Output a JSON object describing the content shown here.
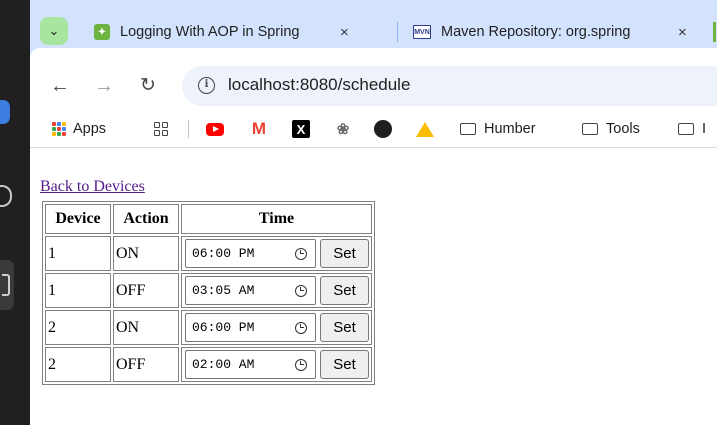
{
  "browser": {
    "tabs": [
      {
        "title": "Logging With AOP in Spring",
        "close": "×",
        "favicon": "spring-leaf-icon"
      },
      {
        "title": "Maven Repository: org.spring",
        "close": "×",
        "favicon": "mvn-icon"
      }
    ],
    "url": "localhost:8080/schedule"
  },
  "bookmarks": {
    "apps_label": "Apps",
    "items": [
      {
        "label": "Humber",
        "icon": "folder-icon"
      },
      {
        "label": "Tools",
        "icon": "folder-icon"
      },
      {
        "label": "I",
        "icon": "folder-icon"
      }
    ]
  },
  "page": {
    "back_link": "Back to Devices",
    "table": {
      "headers": {
        "device": "Device",
        "action": "Action",
        "time": "Time"
      },
      "set_label": "Set",
      "rows": [
        {
          "device": "1",
          "action": "ON",
          "time": "06:00 PM"
        },
        {
          "device": "1",
          "action": "OFF",
          "time": "03:05 AM"
        },
        {
          "device": "2",
          "action": "ON",
          "time": "06:00 PM"
        },
        {
          "device": "2",
          "action": "OFF",
          "time": "02:00 AM"
        }
      ]
    }
  },
  "colors": {
    "tab_strip": "#d3e3fd",
    "link_visited": "#551a8b",
    "spring_green": "#6db33f"
  }
}
